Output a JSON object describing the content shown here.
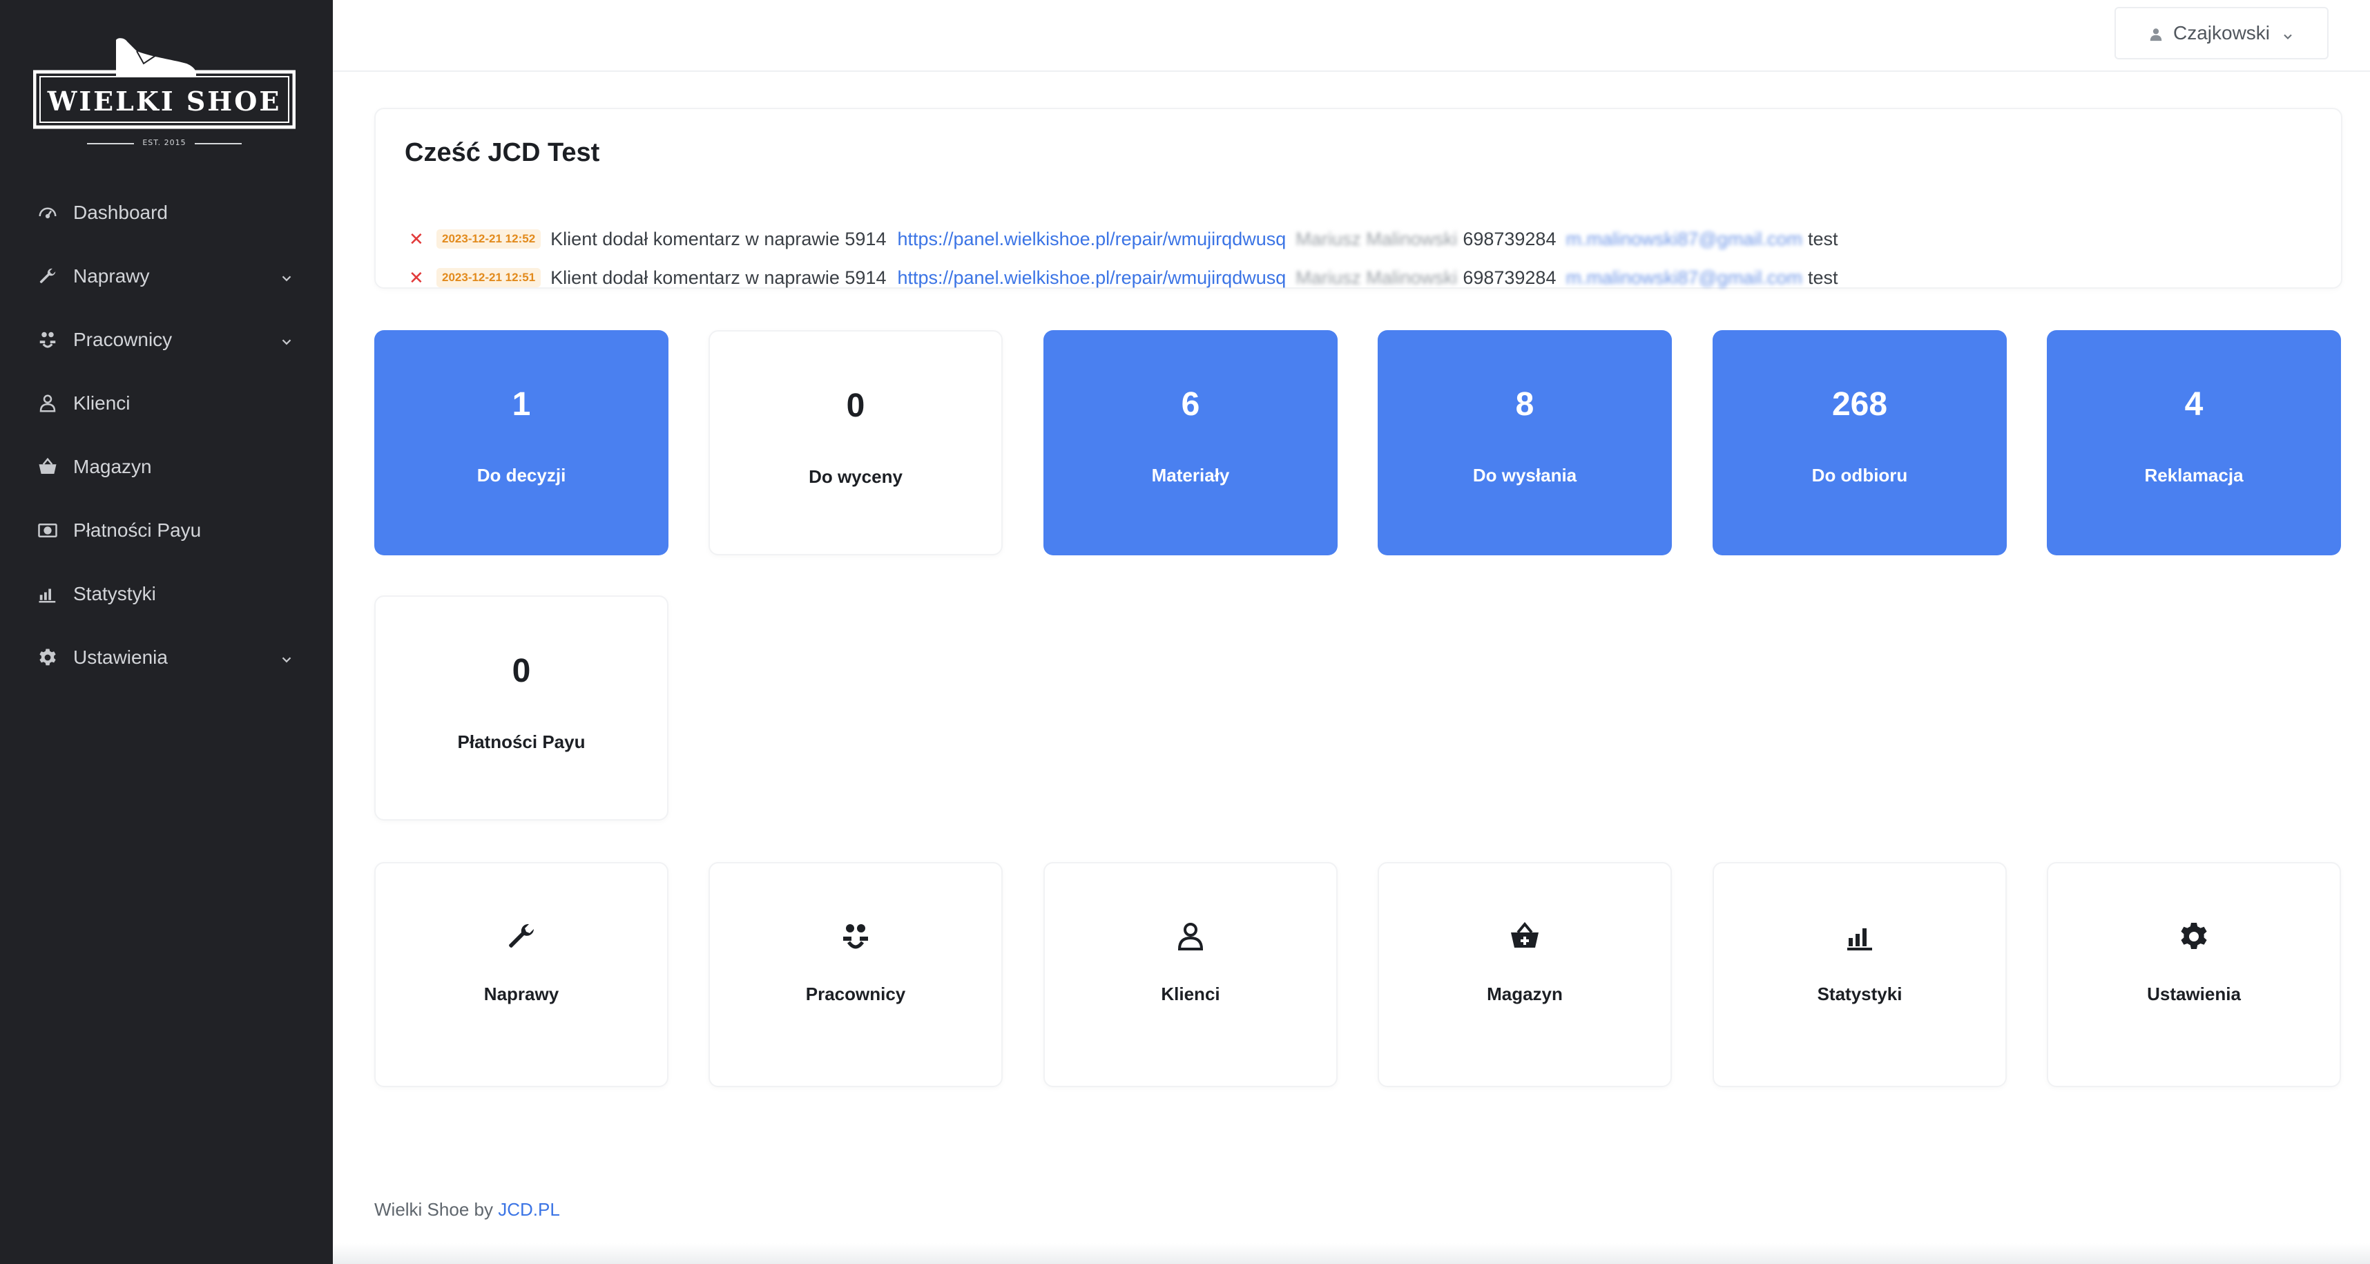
{
  "brand": {
    "name": "WIELKI SHOE",
    "est": "EST. 2015"
  },
  "sidebar": {
    "items": [
      {
        "label": "Dashboard",
        "icon": "dashboard-gauge-icon",
        "expandable": false
      },
      {
        "label": "Naprawy",
        "icon": "wrench-icon",
        "expandable": true
      },
      {
        "label": "Pracownicy",
        "icon": "users-icon",
        "expandable": true
      },
      {
        "label": "Klienci",
        "icon": "user-icon",
        "expandable": false
      },
      {
        "label": "Magazyn",
        "icon": "basket-icon",
        "expandable": false
      },
      {
        "label": "Płatności Payu",
        "icon": "money-icon",
        "expandable": false
      },
      {
        "label": "Statystyki",
        "icon": "chart-bars-icon",
        "expandable": false
      },
      {
        "label": "Ustawienia",
        "icon": "gear-icon",
        "expandable": true
      }
    ]
  },
  "header": {
    "user": "Czajkowski"
  },
  "greeting": "Cześć JCD Test",
  "notifications": [
    {
      "timestamp": "2023-12-21 12:52",
      "text": "Klient dodał komentarz w naprawie 5914",
      "link": "https://panel.wielkishoe.pl/repair/wmujirqdwusq",
      "name": "Mariusz Malinowski",
      "phone": "698739284",
      "email": "m.malinowski87@gmail.com",
      "comment": "test"
    },
    {
      "timestamp": "2023-12-21 12:51",
      "text": "Klient dodał komentarz w naprawie 5914",
      "link": "https://panel.wielkishoe.pl/repair/wmujirqdwusq",
      "name": "Mariusz Malinowski",
      "phone": "698739284",
      "email": "m.malinowski87@gmail.com",
      "comment": "test"
    }
  ],
  "stats": [
    {
      "value": "1",
      "label": "Do decyzji",
      "style": "blue"
    },
    {
      "value": "0",
      "label": "Do wyceny",
      "style": "white"
    },
    {
      "value": "6",
      "label": "Materiały",
      "style": "blue"
    },
    {
      "value": "8",
      "label": "Do wysłania",
      "style": "blue"
    },
    {
      "value": "268",
      "label": "Do odbioru",
      "style": "blue"
    },
    {
      "value": "4",
      "label": "Reklamacja",
      "style": "blue"
    },
    {
      "value": "0",
      "label": "Płatności Payu",
      "style": "white"
    }
  ],
  "shortcuts": [
    {
      "label": "Naprawy",
      "icon": "wrench-icon"
    },
    {
      "label": "Pracownicy",
      "icon": "users-icon"
    },
    {
      "label": "Klienci",
      "icon": "user-icon"
    },
    {
      "label": "Magazyn",
      "icon": "basket-icon"
    },
    {
      "label": "Statystyki",
      "icon": "chart-bars-icon"
    },
    {
      "label": "Ustawienia",
      "icon": "gear-icon"
    }
  ],
  "footer": {
    "text": "Wielki Shoe by",
    "link": "JCD.PL"
  },
  "colors": {
    "sidebar_bg": "#212226",
    "accent_blue": "#4a80f0",
    "link": "#3b74e5",
    "timestamp_bg": "#fdf1df",
    "timestamp_fg": "#e28a1c",
    "close_red": "#e23a3a"
  }
}
